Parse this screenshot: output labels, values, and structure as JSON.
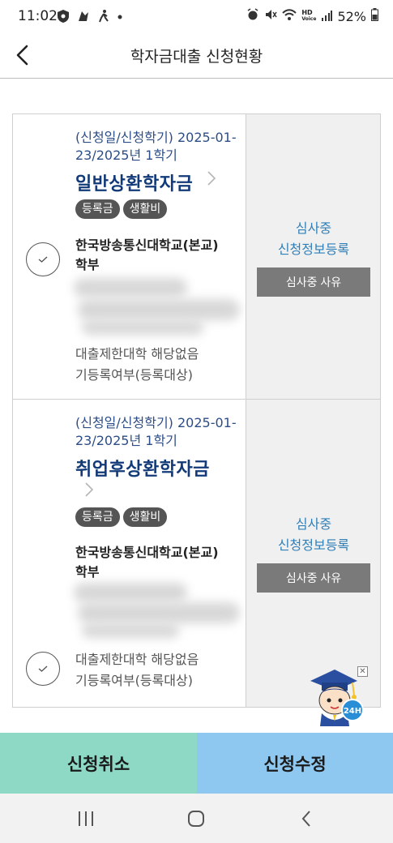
{
  "status_bar": {
    "time": "11:02",
    "battery": "52%",
    "network_label_top": "HD",
    "network_label_bottom": "Voice"
  },
  "header": {
    "title": "학자금대출 신청현황"
  },
  "applications": [
    {
      "apply_date_label": "(신청일/신청학기) 2025-01-23/2025년 1학기",
      "loan_type": "일반상환학자금",
      "tags": [
        "등록금",
        "생활비"
      ],
      "school": "한국방송통신대학교(본교)",
      "department": "학부",
      "restriction": "대출제한대학 해당없음",
      "registration": "기등록여부(등록대상)",
      "status": "심사중",
      "status_detail": "신청정보등록",
      "reason_button": "심사중 사유"
    },
    {
      "apply_date_label": "(신청일/신청학기) 2025-01-23/2025년 1학기",
      "loan_type": "취업후상환학자금",
      "tags": [
        "등록금",
        "생활비"
      ],
      "school": "한국방송통신대학교(본교)",
      "department": "학부",
      "restriction": "대출제한대학 해당없음",
      "registration": "기등록여부(등록대상)",
      "status": "심사중",
      "status_detail": "신청정보등록",
      "reason_button": "심사중 사유"
    }
  ],
  "mascot": {
    "badge": "24H",
    "close_icon": "close-icon"
  },
  "actions": {
    "cancel_label": "신청취소",
    "edit_label": "신청수정"
  },
  "colors": {
    "cancel_bg": "#8ed9c5",
    "edit_bg": "#8ec8f1",
    "status_blue": "#2f7fb8",
    "title_navy": "#123a78"
  }
}
